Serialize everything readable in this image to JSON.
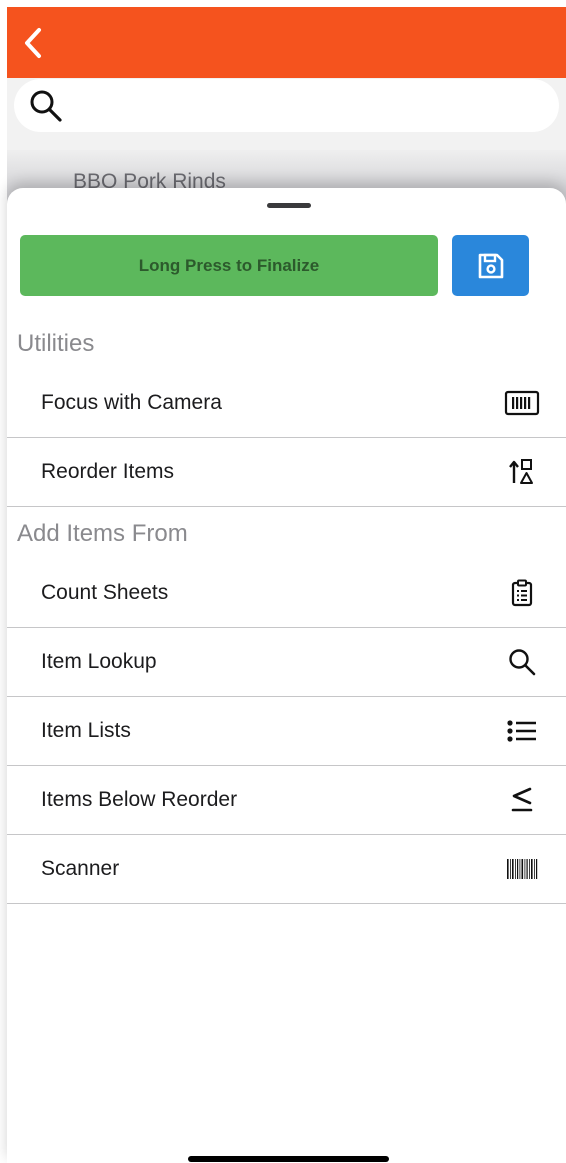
{
  "background": {
    "list_peek_item": "BBQ Pork Rinds"
  },
  "sheet": {
    "finalize_label": "Long Press to Finalize",
    "sections": [
      {
        "title": "Utilities",
        "items": [
          {
            "label": "Focus with Camera",
            "icon": "camera-focus-icon"
          },
          {
            "label": "Reorder Items",
            "icon": "reorder-icon"
          }
        ]
      },
      {
        "title": "Add Items From",
        "items": [
          {
            "label": "Count Sheets",
            "icon": "clipboard-icon"
          },
          {
            "label": "Item Lookup",
            "icon": "search-icon"
          },
          {
            "label": "Item Lists",
            "icon": "list-icon"
          },
          {
            "label": "Items Below Reorder",
            "icon": "less-than-equal-icon"
          },
          {
            "label": "Scanner",
            "icon": "barcode-icon"
          }
        ]
      }
    ]
  },
  "colors": {
    "nav_bar": "#f5531e",
    "finalize_button": "#5cb85c",
    "save_button": "#2a87db"
  }
}
